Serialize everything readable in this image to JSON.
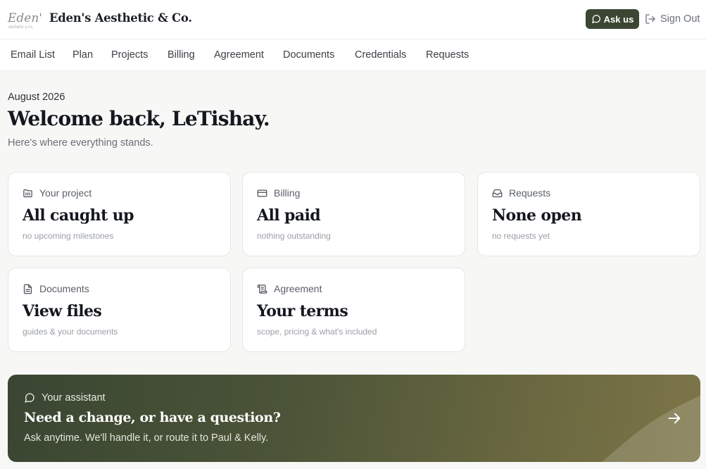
{
  "brand": {
    "logo_text": "Eden's",
    "logo_subtext": "AESTHETIC & CO.",
    "name": "Eden's Aesthetic & Co."
  },
  "header": {
    "ask_label": "Ask us",
    "signout_label": "Sign Out"
  },
  "nav": {
    "items": [
      {
        "label": "Email List"
      },
      {
        "label": "Plan"
      },
      {
        "label": "Projects"
      },
      {
        "label": "Billing"
      },
      {
        "label": "Agreement"
      },
      {
        "label": "Documents"
      },
      {
        "label": "Credentials"
      },
      {
        "label": "Requests"
      }
    ]
  },
  "dashboard": {
    "date": "August 2026",
    "welcome": "Welcome back, LeTishay.",
    "subtitle": "Here's where everything stands."
  },
  "cards": [
    {
      "label": "Your project",
      "title": "All caught up",
      "sub": "no upcoming milestones",
      "icon": "folder-icon"
    },
    {
      "label": "Billing",
      "title": "All paid",
      "sub": "nothing outstanding",
      "icon": "credit-card-icon"
    },
    {
      "label": "Requests",
      "title": "None open",
      "sub": "no requests yet",
      "icon": "inbox-icon"
    },
    {
      "label": "Documents",
      "title": "View files",
      "sub": "guides & your documents",
      "icon": "file-text-icon"
    },
    {
      "label": "Agreement",
      "title": "Your terms",
      "sub": "scope, pricing & what's included",
      "icon": "scroll-icon"
    }
  ],
  "assistant": {
    "label": "Your assistant",
    "title": "Need a change, or have a question?",
    "sub": "Ask anytime. We'll handle it, or route it to Paul & Kelly.",
    "icon": "chat-bubble-icon"
  },
  "colors": {
    "accent": "#3b4633",
    "background": "#f7f7f6",
    "card": "#ffffff"
  }
}
